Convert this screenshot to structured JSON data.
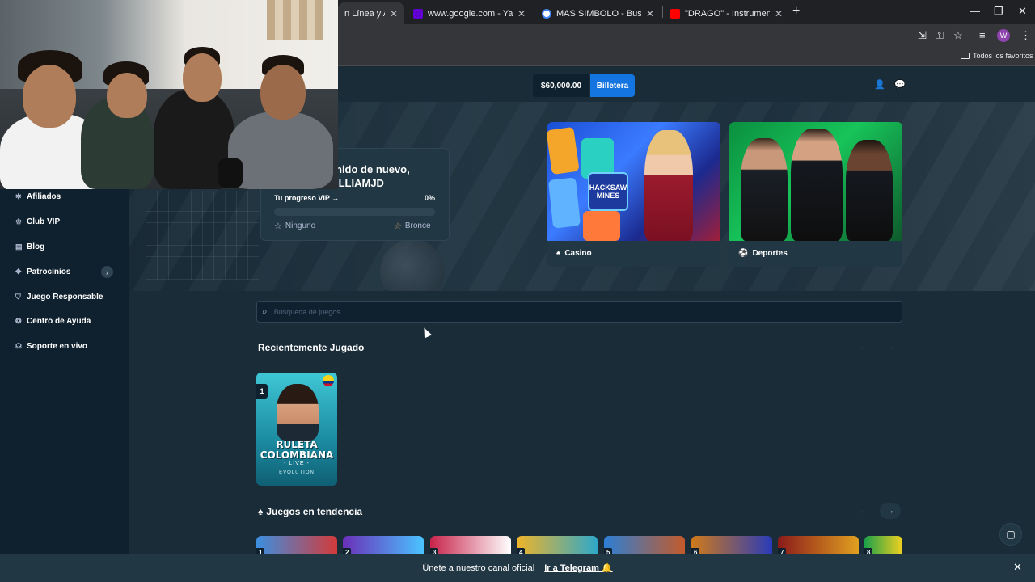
{
  "browser": {
    "tabs": [
      {
        "title": "n Línea y Apues",
        "active": true
      },
      {
        "title": "www.google.com - Yahoo Searc"
      },
      {
        "title": "MAS SIMBOLO - Buscar con Go"
      },
      {
        "title": "\"DRAGO\" - Instrumental Drill ty"
      }
    ],
    "bookmarks_folder": "Todos los favoritos",
    "profile_initial": "W"
  },
  "header": {
    "balance": "$60,000.00",
    "wallet_label": "Billetera"
  },
  "vip": {
    "welcome_line1": "nido de nuevo,",
    "welcome_line2": "ILLIAMJD",
    "progress_label": "Tu progreso VIP →",
    "progress_percent": "0%",
    "progress_value": 0,
    "current_level": "Ninguno",
    "next_level": "Bronce"
  },
  "categories": [
    {
      "label": "Casino",
      "icon": "casino-card-icon"
    },
    {
      "label": "Deportes",
      "icon": "ball-icon"
    }
  ],
  "casino_art_text": "HACKSAW MINES",
  "sidebar": {
    "items": [
      {
        "label": "Afiliados",
        "icon": "affiliate-icon"
      },
      {
        "label": "Club VIP",
        "icon": "trophy-icon"
      },
      {
        "label": "Blog",
        "icon": "blog-icon"
      },
      {
        "label": "Patrocinios",
        "icon": "sponsor-icon"
      },
      {
        "label": "Juego Responsable",
        "icon": "shield-icon"
      },
      {
        "label": "Centro de Ayuda",
        "icon": "help-icon"
      },
      {
        "label": "Soporte en vivo",
        "icon": "headset-icon"
      }
    ]
  },
  "search": {
    "placeholder": "Búsqueda de juegos ..."
  },
  "recent": {
    "title": "Recientemente Jugado",
    "game": {
      "rank": "1",
      "title_line1": "RULETA",
      "title_line2": "COLOMBIANA",
      "subtitle": "- LIVE -",
      "provider": "EVOLUTION"
    }
  },
  "trending": {
    "title": "Juegos en tendencia",
    "ranks": [
      "1",
      "2",
      "3",
      "4",
      "5",
      "6",
      "7",
      "8"
    ]
  },
  "bottom_bar": {
    "text": "Únete a nuestro canal oficial",
    "link": "Ir a Telegram 🔔"
  },
  "colors": {
    "bg": "#1a2c38",
    "sidebar": "#0f212e",
    "accent": "#1475e1",
    "card": "#213743"
  }
}
